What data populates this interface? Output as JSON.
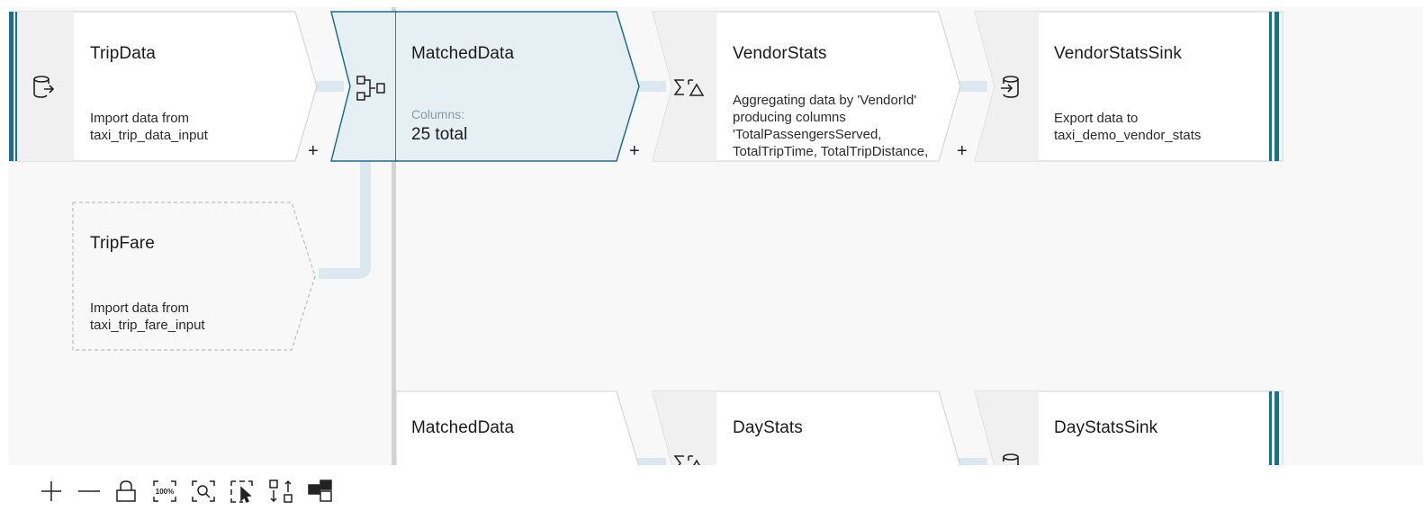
{
  "nodes": {
    "tripdata": {
      "title": "TripData",
      "desc": "Import data from\ntaxi_trip_data_input",
      "add": "+",
      "icon": "source-icon"
    },
    "join": {
      "icon": "join-icon"
    },
    "matcheddata": {
      "title": "MatchedData",
      "columns_label": "Columns:",
      "columns_value": "25 total",
      "add": "+"
    },
    "vendorstats": {
      "title": "VendorStats",
      "desc": "Aggregating data by 'VendorId'\nproducing columns\n'TotalPassengersServed,\nTotalTripTime, TotalTripDistance,\nTotalTripFare'",
      "add": "+",
      "icon": "aggregate-icon"
    },
    "vendorstatssink": {
      "title": "VendorStatsSink",
      "desc": "Export data to\ntaxi_demo_vendor_stats",
      "icon": "sink-icon"
    },
    "tripfare": {
      "title": "TripFare",
      "desc": "Import data from\ntaxi_trip_fare_input"
    },
    "matcheddata2": {
      "title": "MatchedData"
    },
    "daystats": {
      "title": "DayStats",
      "icon": "aggregate-icon"
    },
    "daystatssink": {
      "title": "DayStatsSink",
      "icon": "sink-icon"
    }
  },
  "toolbar": [
    {
      "name": "zoom-in-icon"
    },
    {
      "name": "zoom-out-icon"
    },
    {
      "name": "lock-icon"
    },
    {
      "name": "zoom-100-icon",
      "text": "100%"
    },
    {
      "name": "zoom-fit-icon"
    },
    {
      "name": "multi-select-icon"
    },
    {
      "name": "auto-align-icon"
    },
    {
      "name": "minimap-icon"
    }
  ],
  "colors": {
    "canvas": "#f8f8f8",
    "node_fill": "#ffffff",
    "node_border": "#cfcfcf",
    "icon_strip": "#f0f0f0",
    "accent": "#1f6f8b",
    "selected_fill": "#e6eff3",
    "connector": "#dbe8ef",
    "separator": "#d3d3d3"
  }
}
